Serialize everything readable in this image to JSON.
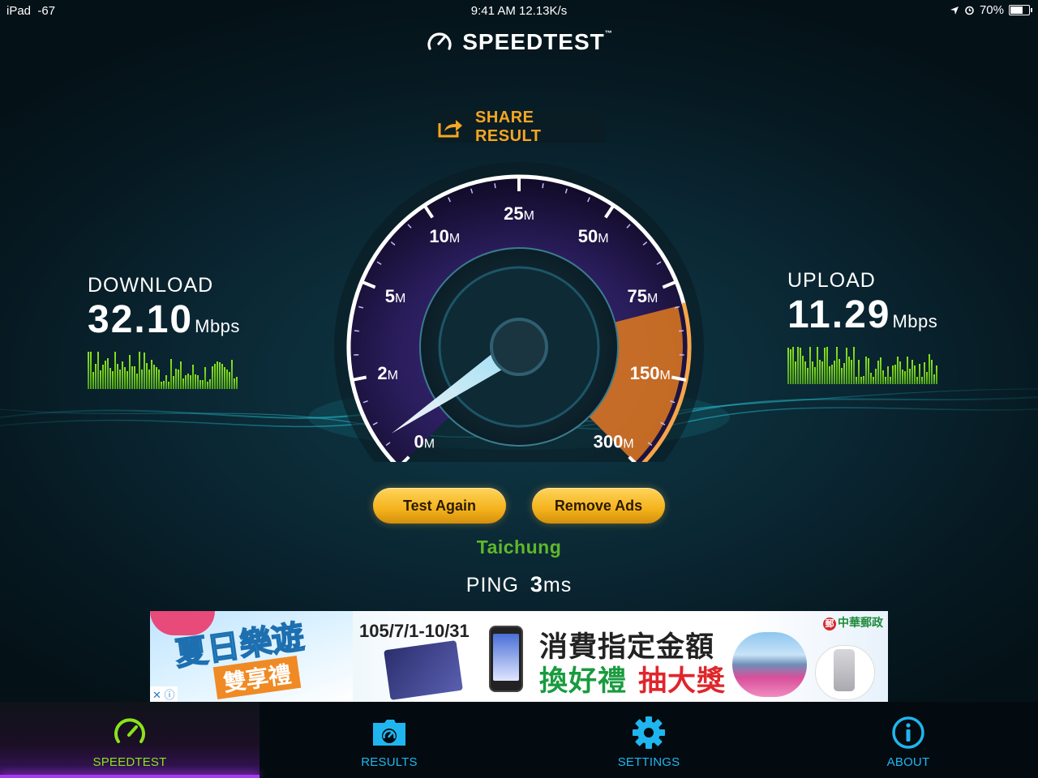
{
  "status_bar": {
    "device": "iPad",
    "signal": "-67",
    "time_speed": "9:41 AM 12.13K/s",
    "battery": "70%",
    "battery_level": 0.7
  },
  "brand": {
    "name": "SPEEDTEST",
    "tm": "™",
    "icon": "speedometer-icon"
  },
  "share": {
    "label": "SHARE RESULT",
    "icon": "share-icon"
  },
  "download": {
    "title": "DOWNLOAD",
    "value": "32.10",
    "unit": "Mbps"
  },
  "upload": {
    "title": "UPLOAD",
    "value": "11.29",
    "unit": "Mbps"
  },
  "gauge": {
    "labels": [
      {
        "num": "0",
        "unit": "M"
      },
      {
        "num": "2",
        "unit": "M"
      },
      {
        "num": "5",
        "unit": "M"
      },
      {
        "num": "10",
        "unit": "M"
      },
      {
        "num": "25",
        "unit": "M"
      },
      {
        "num": "50",
        "unit": "M"
      },
      {
        "num": "75",
        "unit": "M"
      },
      {
        "num": "150",
        "unit": "M"
      },
      {
        "num": "300",
        "unit": "M"
      }
    ],
    "colors": {
      "arc": "#7a4df0",
      "arc_glow": "#c7a6ff",
      "upload_arc": "#f08a24"
    }
  },
  "buttons": {
    "test_again": "Test Again",
    "remove_ads": "Remove Ads"
  },
  "server": "Taichung",
  "ping": {
    "label": "PING",
    "value": "3",
    "unit": "ms"
  },
  "ad": {
    "slogan": "夏日樂遊",
    "subtitle": "雙享禮",
    "date": "105/7/1-10/31",
    "line1": "消費指定金額",
    "line2_green": "換好禮",
    "line2_red": "抽大獎",
    "sponsor": "中華郵政",
    "sponsor_logo": "郵",
    "adchoices": "✕ ⓘ"
  },
  "tabs": [
    {
      "label": "SPEEDTEST",
      "icon": "speedometer-icon",
      "active": true
    },
    {
      "label": "RESULTS",
      "icon": "results-folder-icon",
      "active": false
    },
    {
      "label": "SETTINGS",
      "icon": "gear-icon",
      "active": false
    },
    {
      "label": "ABOUT",
      "icon": "info-icon",
      "active": false
    }
  ],
  "colors": {
    "accent_green": "#8be31c",
    "accent_blue": "#1fb6f0",
    "accent_orange": "#f5a623",
    "tab_active": "#a63cf0"
  }
}
